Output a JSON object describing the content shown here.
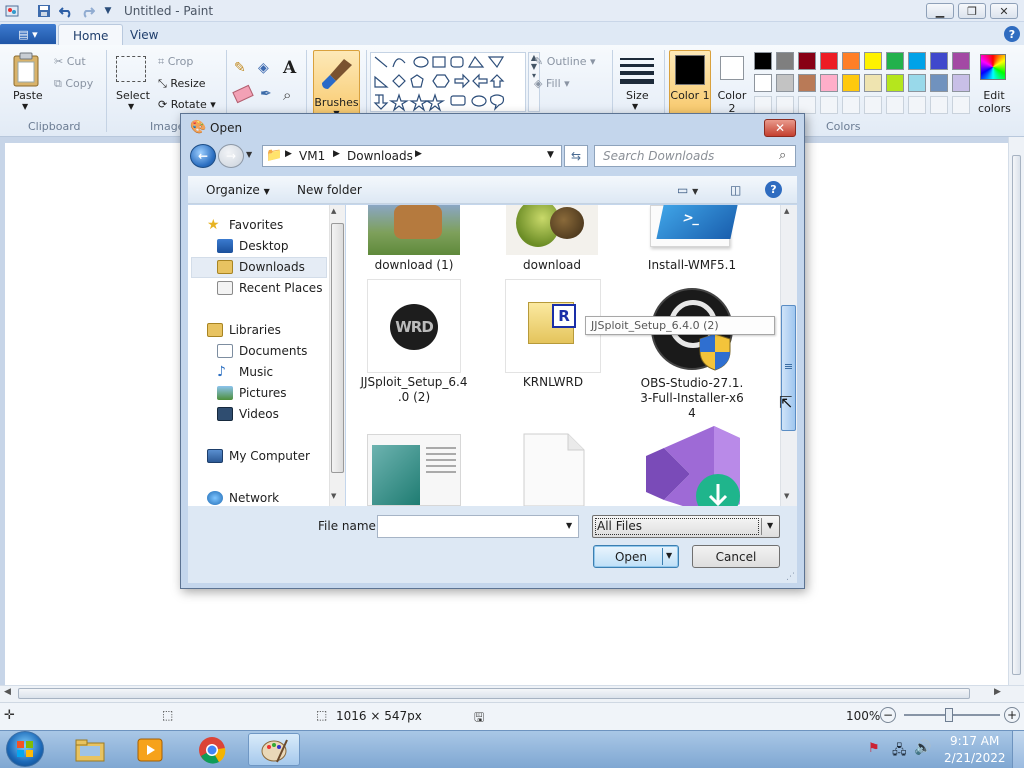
{
  "window": {
    "title": "Untitled - Paint"
  },
  "ribbon": {
    "file_menu_icon": "file-menu-icon",
    "tabs": [
      "Home",
      "View"
    ],
    "clipboard": {
      "paste": "Paste",
      "cut": "Cut",
      "copy": "Copy",
      "group": "Clipboard"
    },
    "image": {
      "select": "Select",
      "crop": "Crop",
      "resize": "Resize",
      "rotate": "Rotate",
      "group": "Image"
    },
    "tools": {
      "brushes": "Brushes"
    },
    "shapes": {
      "outline": "Outline",
      "fill": "Fill"
    },
    "size": "Size",
    "color1": "Color 1",
    "color2": "Color 2",
    "colors_group": "Colors",
    "edit_colors": "Edit colors",
    "palette": [
      "#000000",
      "#7f7f7f",
      "#880015",
      "#ed1c24",
      "#ff7f27",
      "#fff200",
      "#22b14c",
      "#00a2e8",
      "#3f48cc",
      "#a349a4",
      "#ffffff",
      "#c3c3c3",
      "#b97a57",
      "#ffaec9",
      "#ffc90e",
      "#efe4b0",
      "#b5e61d",
      "#99d9ea",
      "#7092be",
      "#c8bfe7"
    ]
  },
  "dialog": {
    "title": "Open",
    "breadcrumb": [
      "VM1",
      "Downloads"
    ],
    "search_placeholder": "Search Downloads",
    "organize": "Organize",
    "new_folder": "New folder",
    "nav": {
      "favorites": "Favorites",
      "favorite_items": [
        "Desktop",
        "Downloads",
        "Recent Places"
      ],
      "libraries": "Libraries",
      "library_items": [
        "Documents",
        "Music",
        "Pictures",
        "Videos"
      ],
      "computer": "My Computer",
      "network": "Network"
    },
    "files": [
      {
        "name": "download (1)"
      },
      {
        "name": "download"
      },
      {
        "name": "Install-WMF5.1"
      },
      {
        "name": "JJSploit_Setup_6.4.0 (2)",
        "label_lines": [
          "JJSploit_Setup_6.4",
          ".0 (2)"
        ]
      },
      {
        "name": "KRNLWRD"
      },
      {
        "name": "OBS-Studio-27.1.3-Full-Installer-x64",
        "label_lines": [
          "OBS-Studio-27.1.",
          "3-Full-Installer-x6",
          "4"
        ]
      }
    ],
    "tooltip": "JJSploit_Setup_6.4.0 (2)",
    "file_name_label": "File name:",
    "file_name_value": "",
    "file_type": "All Files",
    "open_button": "Open",
    "cancel_button": "Cancel"
  },
  "status": {
    "dimensions": "1016 × 547px",
    "zoom": "100%"
  },
  "taskbar": {
    "time": "9:17 AM",
    "date": "2/21/2022"
  }
}
